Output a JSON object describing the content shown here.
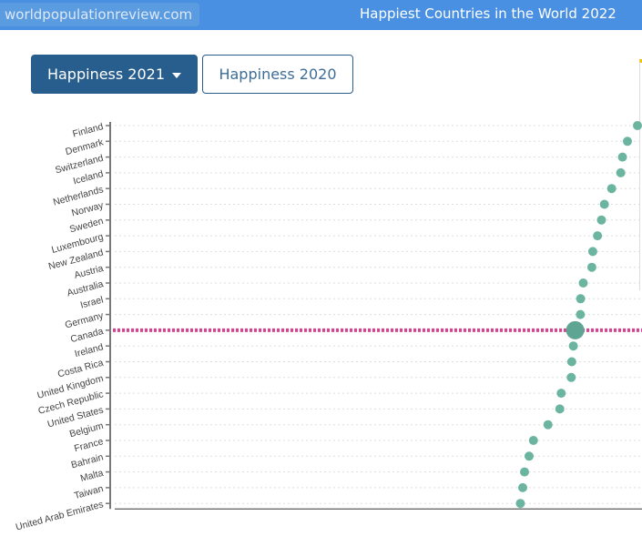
{
  "header": {
    "site": "worldpopulationreview.com",
    "title": "Happiest Countries in the World 2022"
  },
  "buttons": {
    "active": "Happiness 2021",
    "other": "Happiness 2020"
  },
  "chart_data": {
    "type": "scatter",
    "title": "Happiness 2021",
    "xlabel": "",
    "ylabel": "",
    "highlight": "Canada",
    "colors": {
      "dot": "#6bb5a0",
      "highlight_line": "#d6458f"
    },
    "categories": [
      "Finland",
      "Denmark",
      "Switzerland",
      "Iceland",
      "Netherlands",
      "Norway",
      "Sweden",
      "Luxembourg",
      "New Zealand",
      "Austria",
      "Australia",
      "Israel",
      "Germany",
      "Canada",
      "Ireland",
      "Costa Rica",
      "United Kingdom",
      "Czech Republic",
      "United States",
      "Belgium",
      "France",
      "Bahrain",
      "Malta",
      "Taiwan",
      "United Arab Emirates"
    ],
    "values": [
      7.842,
      7.62,
      7.571,
      7.554,
      7.464,
      7.392,
      7.363,
      7.324,
      7.277,
      7.268,
      7.183,
      7.157,
      7.155,
      7.103,
      7.085,
      7.069,
      7.064,
      6.965,
      6.951,
      6.834,
      6.69,
      6.647,
      6.602,
      6.584,
      6.561
    ]
  }
}
